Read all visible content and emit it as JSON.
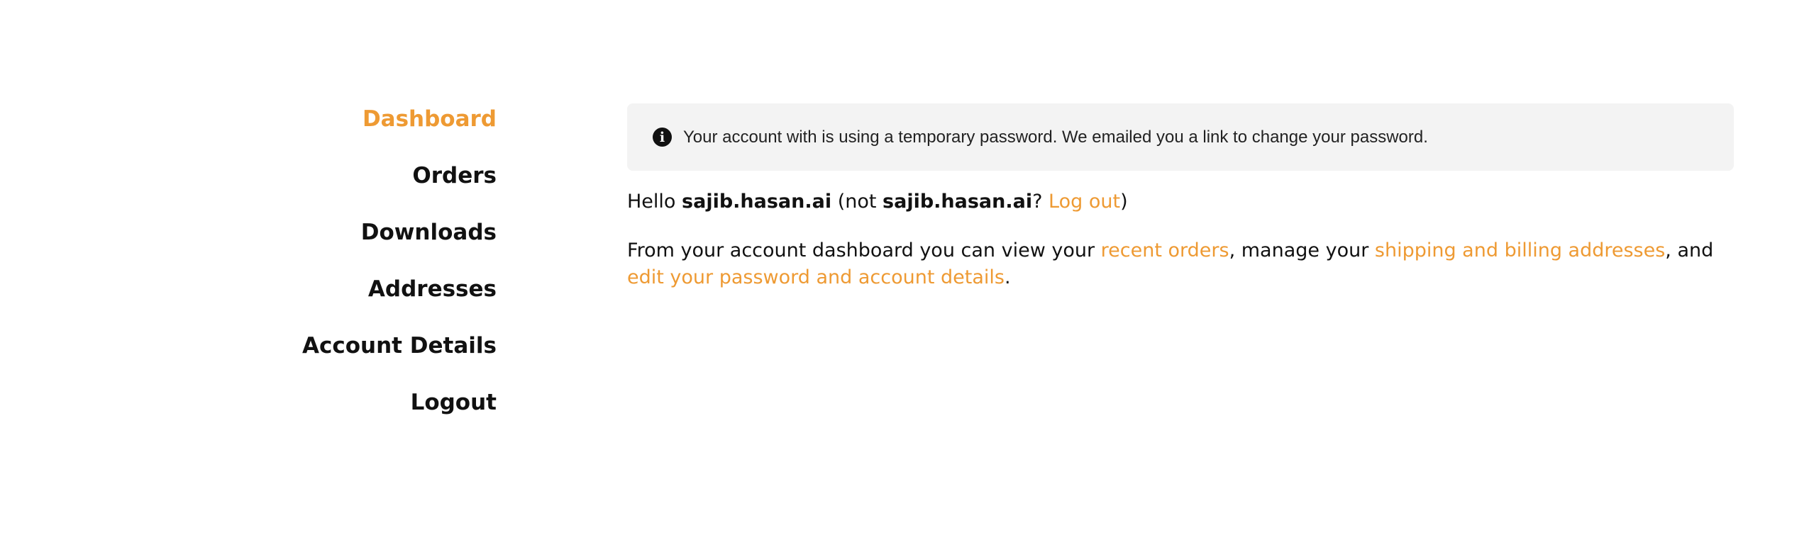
{
  "sidebar": {
    "items": [
      {
        "label": "Dashboard",
        "active": true
      },
      {
        "label": "Orders",
        "active": false
      },
      {
        "label": "Downloads",
        "active": false
      },
      {
        "label": "Addresses",
        "active": false
      },
      {
        "label": "Account Details",
        "active": false
      },
      {
        "label": "Logout",
        "active": false
      }
    ]
  },
  "notice": {
    "icon": "info-icon",
    "text": "Your account with is using a temporary password. We emailed you a link to change your password."
  },
  "greeting": {
    "hello": "Hello ",
    "username": "sajib.hasan.ai",
    "not_open": " (not ",
    "not_username": "sajib.hasan.ai",
    "question": "? ",
    "logout_link": "Log out",
    "close": ")"
  },
  "intro": {
    "part1": "From your account dashboard you can view your ",
    "recent_orders_link": "recent orders",
    "part2": ", manage your ",
    "addresses_link": "shipping and billing addresses",
    "part3": ", and ",
    "account_link": "edit your password and account details",
    "part4": "."
  },
  "colors": {
    "accent": "#ee9a33",
    "text": "#111111",
    "notice_bg": "#f3f3f3"
  }
}
